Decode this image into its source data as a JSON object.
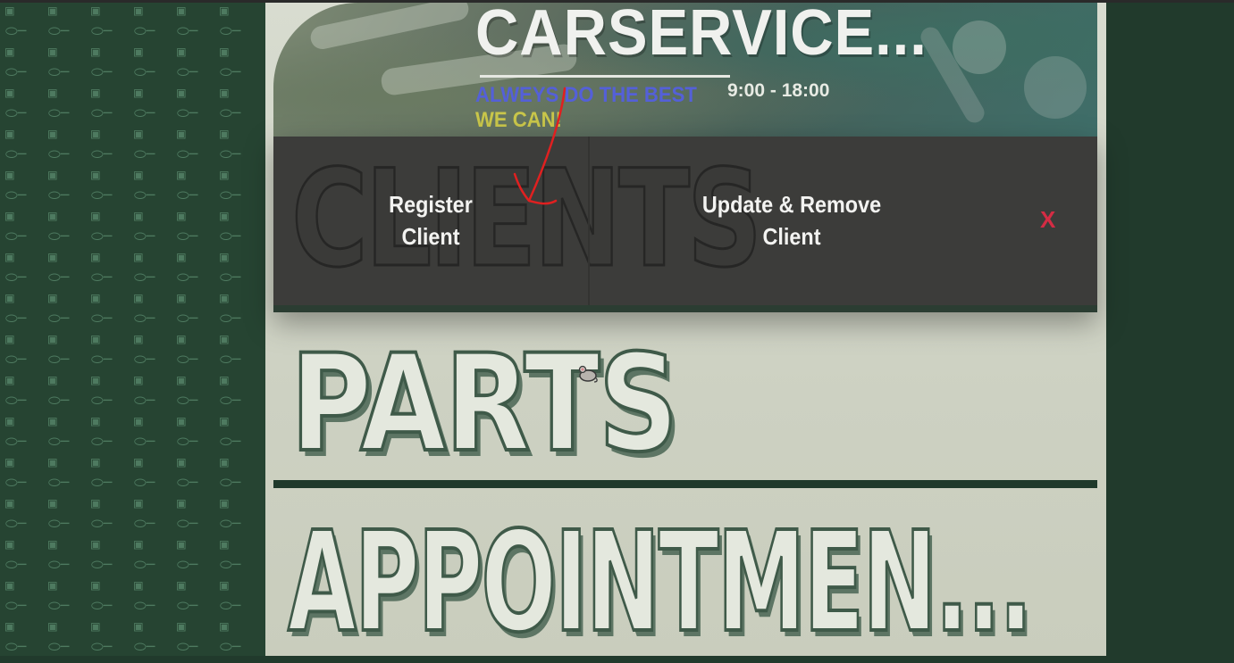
{
  "colors": {
    "page_bg": "#213a2c",
    "pattern_bg": "#264432",
    "pattern_icon": "#4e7a60",
    "main_bg": "#d2d6c8",
    "panel_bg": "#3c3c3a",
    "accent_blue": "#5460d8",
    "accent_yellow": "#c9c64a",
    "close_red": "#d42c44",
    "separator": "#203a2b"
  },
  "sidebar_pattern": {
    "icons": [
      "car-icon",
      "key-icon"
    ]
  },
  "header": {
    "title": "CARSERVICE...",
    "tagline_line1": "ALWEYS DO THE BEST",
    "tagline_line2": "WE CAN!",
    "hours": "9:00 - 18:00"
  },
  "clients_menu": {
    "section_title": "CLIENTS",
    "register_label_line1": "Register",
    "register_label_line2": "Client",
    "update_label_line1": "Update & Remove",
    "update_label_line2": "Client",
    "close_label": "X"
  },
  "sections": {
    "parts": "PARTS",
    "appointments": "APPOINTMEN..."
  }
}
